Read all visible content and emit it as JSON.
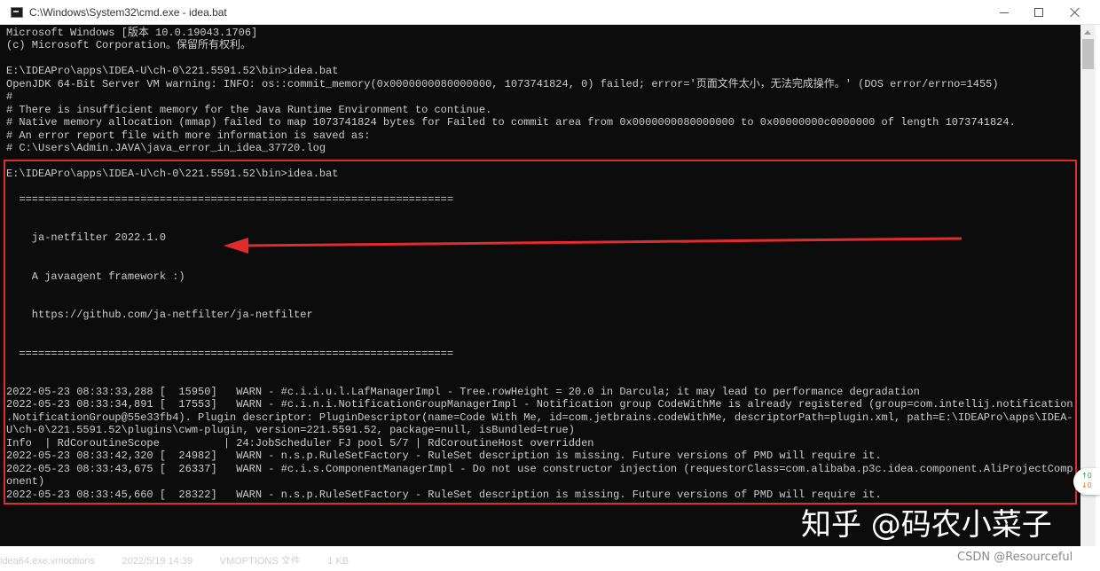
{
  "window": {
    "title": "C:\\Windows\\System32\\cmd.exe - idea.bat",
    "icon": "console-app-icon",
    "controls": [
      "minimize",
      "maximize",
      "close"
    ]
  },
  "console": {
    "lines": [
      "Microsoft Windows [版本 10.0.19043.1706]",
      "(c) Microsoft Corporation。保留所有权利。",
      "",
      "E:\\IDEAPro\\apps\\IDEA-U\\ch-0\\221.5591.52\\bin>idea.bat",
      "OpenJDK 64-Bit Server VM warning: INFO: os::commit_memory(0x0000000080000000, 1073741824, 0) failed; error='页面文件太小，无法完成操作。' (DOS error/errno=1455)",
      "#",
      "# There is insufficient memory for the Java Runtime Environment to continue.",
      "# Native memory allocation (mmap) failed to map 1073741824 bytes for Failed to commit area from 0x0000000080000000 to 0x00000000c0000000 of length 1073741824.",
      "# An error report file with more information is saved as:",
      "# C:\\Users\\Admin.JAVA\\java_error_in_idea_37720.log",
      "",
      "E:\\IDEAPro\\apps\\IDEA-U\\ch-0\\221.5591.52\\bin>idea.bat",
      "",
      "  ====================================================================",
      "",
      "",
      "    ja-netfilter 2022.1.0",
      "",
      "",
      "    A javaagent framework :)",
      "",
      "",
      "    https://github.com/ja-netfilter/ja-netfilter",
      "",
      "",
      "  ====================================================================",
      "",
      "",
      "2022-05-23 08:33:33,288 [  15950]   WARN - #c.i.i.u.l.LafManagerImpl - Tree.rowHeight = 20.0 in Darcula; it may lead to performance degradation",
      "2022-05-23 08:33:34,891 [  17553]   WARN - #c.i.n.i.NotificationGroupManagerImpl - Notification group CodeWithMe is already registered (group=com.intellij.notification",
      ".NotificationGroup@55e33fb4). Plugin descriptor: PluginDescriptor(name=Code With Me, id=com.jetbrains.codeWithMe, descriptorPath=plugin.xml, path=E:\\IDEAPro\\apps\\IDEA-",
      "U\\ch-0\\221.5591.52\\plugins\\cwm-plugin, version=221.5591.52, package=null, isBundled=true)",
      "Info  | RdCoroutineScope          | 24:JobScheduler FJ pool 5/7 | RdCoroutineHost overridden",
      "2022-05-23 08:33:42,320 [  24982]   WARN - n.s.p.RuleSetFactory - RuleSet description is missing. Future versions of PMD will require it.",
      "2022-05-23 08:33:43,675 [  26337]   WARN - #c.i.s.ComponentManagerImpl - Do not use constructor injection (requestorClass=com.alibaba.p3c.idea.component.AliProjectComp",
      "onent)",
      "2022-05-23 08:33:45,660 [  28322]   WARN - n.s.p.RuleSetFactory - RuleSet description is missing. Future versions of PMD will require it."
    ]
  },
  "annotation": {
    "highlight_color": "#e02c2c",
    "arrow_target": "A javaagent framework :)"
  },
  "side_widget": {
    "up": "↑0",
    "down": "↓0"
  },
  "background_window": {
    "partial_text": "idea64.exe.vmoptions          2022/5/19 14:39          VMOPTIONS 文件          1 KB"
  },
  "watermarks": {
    "zhihu": "知乎 @码农小菜子",
    "csdn": "CSDN @Resourceful"
  }
}
